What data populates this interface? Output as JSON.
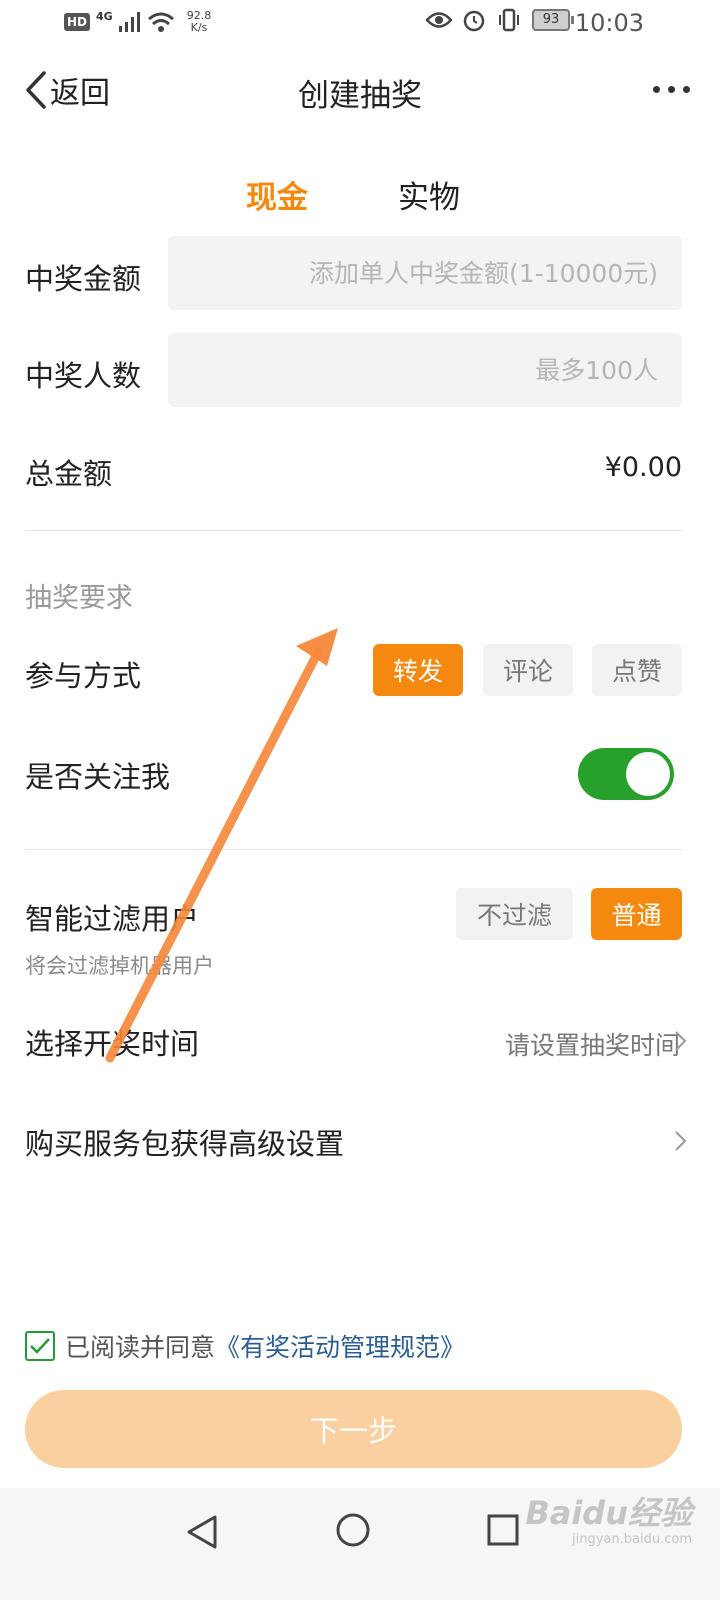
{
  "status_bar": {
    "hd": "HD",
    "signal_gen": "4G",
    "net_speed_value": "92.8",
    "net_speed_unit": "K/s",
    "battery": "93",
    "time": "10:03"
  },
  "nav": {
    "back_label": "返回",
    "title": "创建抽奖"
  },
  "tabs": [
    {
      "label": "现金",
      "active": true
    },
    {
      "label": "实物",
      "active": false
    }
  ],
  "form": {
    "amount_label": "中奖金额",
    "amount_placeholder": "添加单人中奖金额(1-10000元)",
    "count_label": "中奖人数",
    "count_placeholder": "最多100人",
    "total_label": "总金额",
    "total_value": "¥0.00"
  },
  "requirements": {
    "section_title": "抽奖要求",
    "participation_label": "参与方式",
    "participation_options": [
      {
        "label": "转发",
        "selected": true
      },
      {
        "label": "评论",
        "selected": false
      },
      {
        "label": "点赞",
        "selected": false
      }
    ],
    "follow_label": "是否关注我",
    "follow_enabled": true
  },
  "filter": {
    "label": "智能过滤用户",
    "sublabel": "将会过滤掉机器用户",
    "options": [
      {
        "label": "不过滤",
        "selected": false
      },
      {
        "label": "普通",
        "selected": true
      }
    ]
  },
  "draw_time": {
    "label": "选择开奖时间",
    "value": "请设置抽奖时间"
  },
  "advanced": {
    "label": "购买服务包获得高级设置"
  },
  "agreement": {
    "checked": true,
    "prefix": "已阅读并同意",
    "policy": "《有奖活动管理规范》"
  },
  "next_button": "下一步",
  "watermark": {
    "main": "Baidu经验",
    "sub": "jingyan.baidu.com"
  },
  "colors": {
    "accent": "#f5890f",
    "toggle_on": "#27a12c",
    "next_disabled": "#fad0a1",
    "link": "#2b5d96"
  }
}
